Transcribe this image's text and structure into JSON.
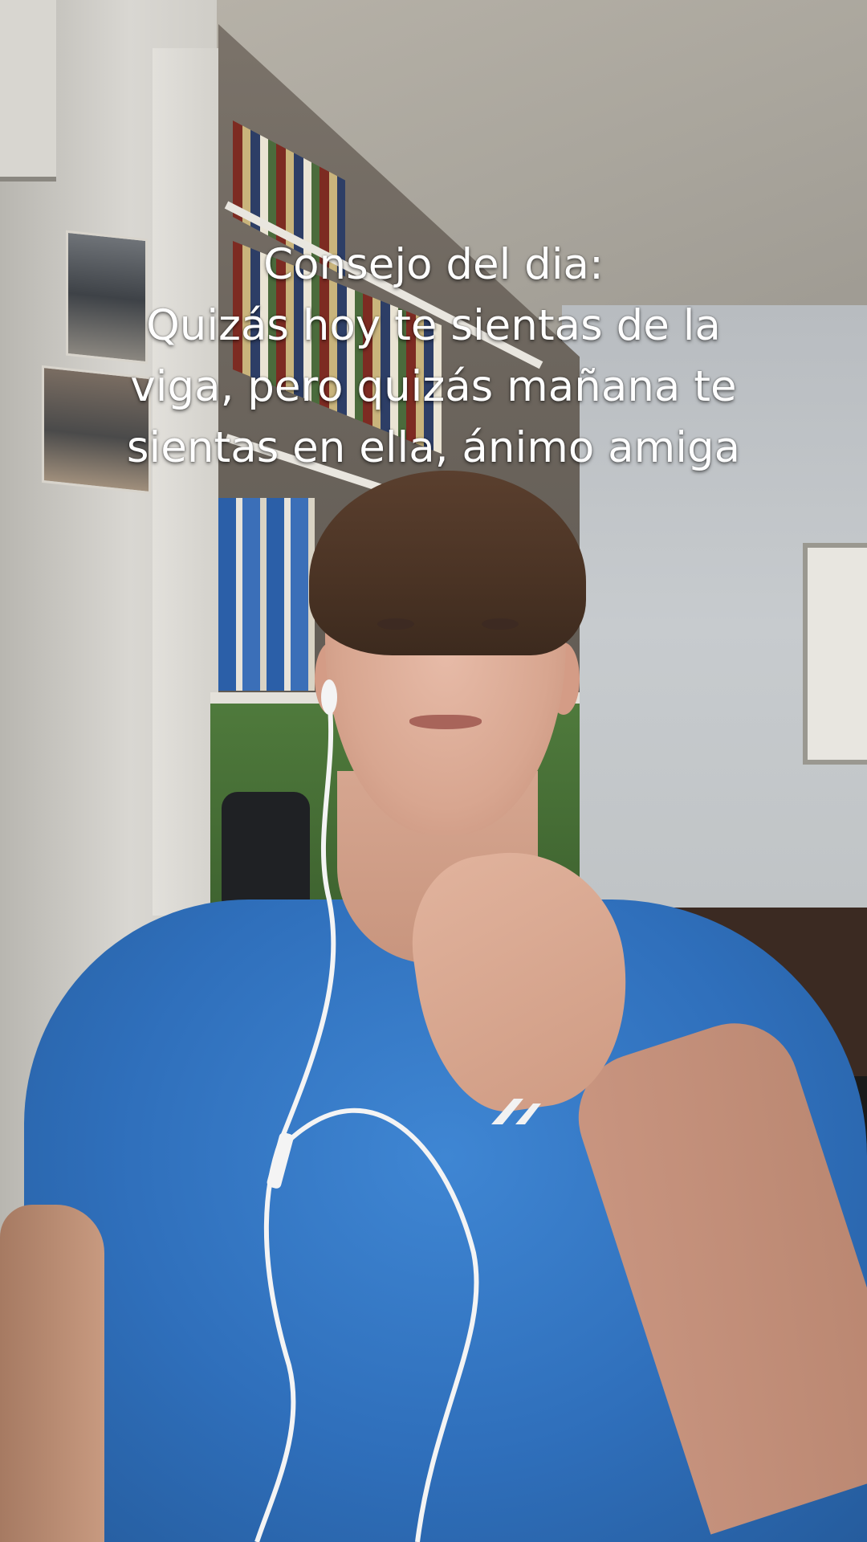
{
  "caption": {
    "lines": [
      "Consejo del dia:",
      "Quizás hoy te sientas de la",
      "viga, pero quizás mañana te",
      "sientas en ella, ánimo amiga"
    ]
  },
  "scene": {
    "shirt_color": "#2f6fbb",
    "cabinet_color": "#4f7a3c",
    "caption_color": "#ffffff"
  }
}
